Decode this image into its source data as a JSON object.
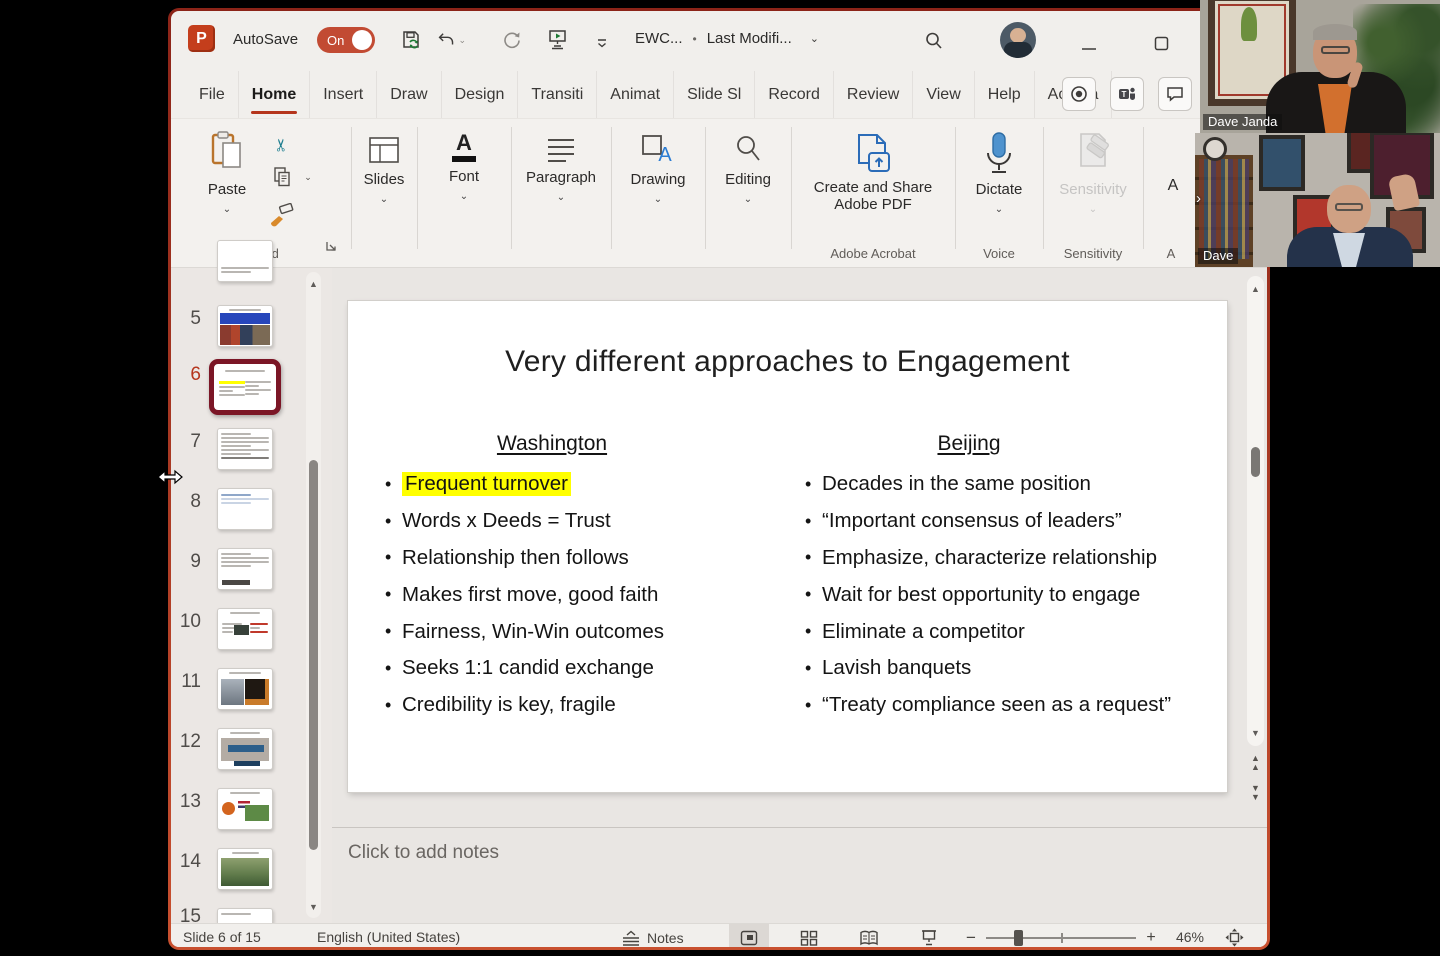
{
  "colors": {
    "accent": "#b5351c",
    "toggle-on": "#c24b33",
    "highlight": "#ffff00",
    "selection": "#7b1626",
    "win-border-top": "#8c2418",
    "win-border-bottom": "#c8502f"
  },
  "titlebar": {
    "app_icon": "P",
    "autosave_label": "AutoSave",
    "autosave_state": "On",
    "doc_title": "EWC...",
    "bullet": "•",
    "doc_modified": "Last Modifi..."
  },
  "tabs": [
    {
      "label": "File"
    },
    {
      "label": "Home"
    },
    {
      "label": "Insert"
    },
    {
      "label": "Draw"
    },
    {
      "label": "Design"
    },
    {
      "label": "Transiti"
    },
    {
      "label": "Animat"
    },
    {
      "label": "Slide Sl"
    },
    {
      "label": "Record"
    },
    {
      "label": "Review"
    },
    {
      "label": "View"
    },
    {
      "label": "Help"
    },
    {
      "label": "Acroba"
    }
  ],
  "ribbon": {
    "paste": "Paste",
    "clipboard_group": "Clipboard",
    "slides": "Slides",
    "font": "Font",
    "paragraph": "Paragraph",
    "drawing": "Drawing",
    "editing": "Editing",
    "adobe_line1": "Create and Share",
    "adobe_line2": "Adobe PDF",
    "adobe_group": "Adobe Acrobat",
    "dictate": "Dictate",
    "voice_group": "Voice",
    "sensitivity": "Sensitivity",
    "sensitivity_group": "Sensitivity",
    "overflow": "A",
    "overflow_group": "A"
  },
  "thumbnails": {
    "slides": [
      {
        "number": "5"
      },
      {
        "number": "6"
      },
      {
        "number": "7"
      },
      {
        "number": "8"
      },
      {
        "number": "9"
      },
      {
        "number": "10"
      },
      {
        "number": "11"
      },
      {
        "number": "12"
      },
      {
        "number": "13"
      },
      {
        "number": "14"
      },
      {
        "number": "15"
      }
    ]
  },
  "slide": {
    "title": "Very different approaches to Engagement",
    "left_header": "Washington",
    "right_header": "Beijing",
    "left_items": [
      "Frequent turnover",
      "Words x Deeds = Trust",
      "Relationship then follows",
      "Makes first move, good faith",
      "Fairness, Win-Win outcomes",
      "Seeks 1:1 candid exchange",
      "Credibility is key, fragile"
    ],
    "right_items": [
      "Decades in the same position",
      "“Important consensus of leaders”",
      "Emphasize, characterize relationship",
      "Wait for best opportunity to engage",
      "Eliminate a competitor",
      "Lavish banquets",
      "“Treaty compliance seen as a request”"
    ]
  },
  "notes": {
    "placeholder": "Click to add notes"
  },
  "status": {
    "slide_indicator": "Slide 6 of 15",
    "language": "English (United States)",
    "notes_label": "Notes",
    "zoom_level": "46%"
  },
  "videos": {
    "feed1_name": "Dave Janda",
    "feed2_name": "Dave"
  }
}
